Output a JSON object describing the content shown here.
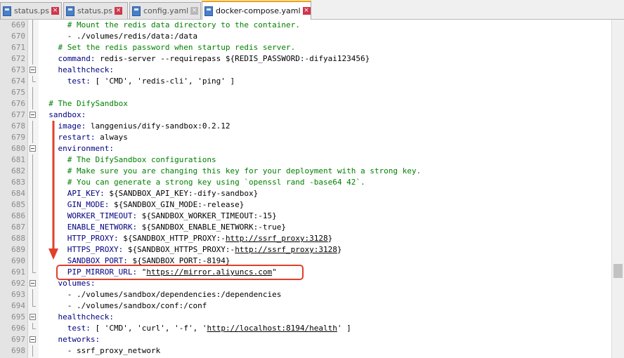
{
  "tabs": [
    {
      "label": "status.ps",
      "active": false,
      "close_dim": false
    },
    {
      "label": "status.ps",
      "active": false,
      "close_dim": false
    },
    {
      "label": "config.yaml",
      "active": false,
      "close_dim": true
    },
    {
      "label": "docker-compose.yaml",
      "active": true,
      "close_dim": false
    }
  ],
  "close_glyph": "×",
  "lines": [
    {
      "n": "669",
      "fold": "line",
      "segs": [
        [
          "      ",
          "t"
        ],
        [
          "# Mount the redis data directory to the container.",
          "c"
        ]
      ]
    },
    {
      "n": "670",
      "fold": "line",
      "segs": [
        [
          "      - ./volumes/redis/data:/data",
          "t"
        ]
      ]
    },
    {
      "n": "671",
      "fold": "line",
      "segs": [
        [
          "    ",
          "t"
        ],
        [
          "# Set the redis password when startup redis server.",
          "c"
        ]
      ]
    },
    {
      "n": "672",
      "fold": "line",
      "segs": [
        [
          "    ",
          "t"
        ],
        [
          "command:",
          "k"
        ],
        [
          " redis-server --requirepass ${REDIS_PASSWORD:-difyai123456}",
          "t"
        ]
      ]
    },
    {
      "n": "673",
      "fold": "box",
      "segs": [
        [
          "    ",
          "t"
        ],
        [
          "healthcheck:",
          "k"
        ]
      ]
    },
    {
      "n": "674",
      "fold": "end",
      "segs": [
        [
          "      ",
          "t"
        ],
        [
          "test:",
          "k"
        ],
        [
          " [ 'CMD', 'redis-cli', 'ping' ]",
          "t"
        ]
      ]
    },
    {
      "n": "675",
      "fold": "line",
      "segs": [
        [
          "",
          "t"
        ]
      ]
    },
    {
      "n": "676",
      "fold": "line",
      "segs": [
        [
          "  ",
          "t"
        ],
        [
          "# The DifySandbox",
          "c"
        ]
      ]
    },
    {
      "n": "677",
      "fold": "box",
      "segs": [
        [
          "  ",
          "t"
        ],
        [
          "sandbox:",
          "k"
        ]
      ]
    },
    {
      "n": "678",
      "fold": "line",
      "segs": [
        [
          "    ",
          "t"
        ],
        [
          "image:",
          "k"
        ],
        [
          " langgenius/dify-sandbox:0.2.12",
          "t"
        ]
      ]
    },
    {
      "n": "679",
      "fold": "line",
      "segs": [
        [
          "    ",
          "t"
        ],
        [
          "restart:",
          "k"
        ],
        [
          " always",
          "t"
        ]
      ]
    },
    {
      "n": "680",
      "fold": "box",
      "segs": [
        [
          "    ",
          "t"
        ],
        [
          "environment:",
          "k"
        ]
      ]
    },
    {
      "n": "681",
      "fold": "line",
      "segs": [
        [
          "      ",
          "t"
        ],
        [
          "# The DifySandbox configurations",
          "c"
        ]
      ]
    },
    {
      "n": "682",
      "fold": "line",
      "segs": [
        [
          "      ",
          "t"
        ],
        [
          "# Make sure you are changing this key for your deployment with a strong key.",
          "c"
        ]
      ]
    },
    {
      "n": "683",
      "fold": "line",
      "segs": [
        [
          "      ",
          "t"
        ],
        [
          "# You can generate a strong key using `openssl rand -base64 42`.",
          "c"
        ]
      ]
    },
    {
      "n": "684",
      "fold": "line",
      "segs": [
        [
          "      ",
          "t"
        ],
        [
          "API_KEY:",
          "k"
        ],
        [
          " ${SANDBOX_API_KEY:-dify-sandbox}",
          "t"
        ]
      ]
    },
    {
      "n": "685",
      "fold": "line",
      "segs": [
        [
          "      ",
          "t"
        ],
        [
          "GIN_MODE:",
          "k"
        ],
        [
          " ${SANDBOX_GIN_MODE:-release}",
          "t"
        ]
      ]
    },
    {
      "n": "686",
      "fold": "line",
      "segs": [
        [
          "      ",
          "t"
        ],
        [
          "WORKER_TIMEOUT:",
          "k"
        ],
        [
          " ${SANDBOX_WORKER_TIMEOUT:-15}",
          "t"
        ]
      ]
    },
    {
      "n": "687",
      "fold": "line",
      "segs": [
        [
          "      ",
          "t"
        ],
        [
          "ENABLE_NETWORK:",
          "k"
        ],
        [
          " ${SANDBOX_ENABLE_NETWORK:-true}",
          "t"
        ]
      ]
    },
    {
      "n": "688",
      "fold": "line",
      "segs": [
        [
          "      ",
          "t"
        ],
        [
          "HTTP_PROXY:",
          "k"
        ],
        [
          " ${SANDBOX_HTTP_PROXY:-",
          "t"
        ],
        [
          "http://ssrf_proxy:3128",
          "u"
        ],
        [
          "}",
          "t"
        ]
      ]
    },
    {
      "n": "689",
      "fold": "line",
      "segs": [
        [
          "      ",
          "t"
        ],
        [
          "HTTPS_PROXY:",
          "k"
        ],
        [
          " ${SANDBOX_HTTPS_PROXY:-",
          "t"
        ],
        [
          "http://ssrf_proxy:3128",
          "u"
        ],
        [
          "}",
          "t"
        ]
      ]
    },
    {
      "n": "690",
      "fold": "line",
      "segs": [
        [
          "      ",
          "t"
        ],
        [
          "SANDBOX_PORT:",
          "k"
        ],
        [
          " ${SANDBOX_PORT:-8194}",
          "t"
        ]
      ]
    },
    {
      "n": "691",
      "fold": "end",
      "segs": [
        [
          "      ",
          "t"
        ],
        [
          "PIP_MIRROR_URL:",
          "k"
        ],
        [
          " \"",
          "t"
        ],
        [
          "https://mirror.aliyuncs.com",
          "u"
        ],
        [
          "\"",
          "t"
        ]
      ]
    },
    {
      "n": "692",
      "fold": "box",
      "segs": [
        [
          "    ",
          "t"
        ],
        [
          "volumes:",
          "k"
        ]
      ]
    },
    {
      "n": "693",
      "fold": "line",
      "segs": [
        [
          "      - ./volumes/sandbox/dependencies:/dependencies",
          "t"
        ]
      ]
    },
    {
      "n": "694",
      "fold": "end",
      "segs": [
        [
          "      - ./volumes/sandbox/conf:/conf",
          "t"
        ]
      ]
    },
    {
      "n": "695",
      "fold": "box",
      "segs": [
        [
          "    ",
          "t"
        ],
        [
          "healthcheck:",
          "k"
        ]
      ]
    },
    {
      "n": "696",
      "fold": "end",
      "segs": [
        [
          "      ",
          "t"
        ],
        [
          "test:",
          "k"
        ],
        [
          " [ 'CMD', 'curl', '-f', '",
          "t"
        ],
        [
          "http://localhost:8194/health",
          "u"
        ],
        [
          "' ]",
          "t"
        ]
      ]
    },
    {
      "n": "697",
      "fold": "box",
      "segs": [
        [
          "    ",
          "t"
        ],
        [
          "networks:",
          "k"
        ]
      ]
    },
    {
      "n": "698",
      "fold": "line",
      "segs": [
        [
          "      - ssrf_proxy_network",
          "t"
        ]
      ]
    }
  ],
  "colors": {
    "keyword": "#000080",
    "comment": "#008000",
    "annotation": "#e0402a",
    "tab_accent": "#f6a000"
  }
}
